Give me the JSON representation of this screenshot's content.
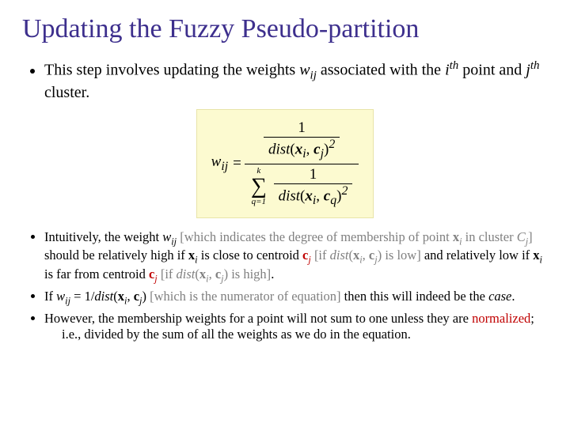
{
  "title": "Updating the Fuzzy Pseudo-partition",
  "bullets": {
    "b1": {
      "t1": "This step involves updating the weights ",
      "w": "w",
      "ij": "ij",
      "t2": " associated with the ",
      "i": "i",
      "th1": "th",
      "t3": " point and ",
      "j": "j",
      "th2": "th",
      "t4": " cluster."
    },
    "b2": {
      "t1": "Intuitively, the weight ",
      "w": "w",
      "ij": "ij",
      "gray1a": " [which indicates the degree of membership of point ",
      "xi_b": "x",
      "xi_s": "i",
      "gray1b": " in cluster ",
      "Cj_b": "C",
      "Cj_s": "j",
      "gray1c": "]",
      "t2": " should be relatively high if ",
      "xib": "x",
      "xis": "i",
      "t3": " is close to centroid ",
      "cjb": "c",
      "cjs": "j",
      "gray2a": " [if ",
      "dist1": "dist",
      "d1p": "(",
      "d1x": "x",
      "d1xi": "i",
      "d1comma": ", ",
      "d1c": "c",
      "d1cj": "j",
      "d1close": ")",
      "gray2b": " is low]",
      "t4": " and relatively low if ",
      "xib2": "x",
      "xis2": "i",
      "t5": " is far from centroid ",
      "cjb2": "c",
      "cjs2": "j",
      "gray3a": " [if ",
      "dist2": "dist",
      "d2p": "(",
      "d2x": "x",
      "d2xi": "i",
      "d2comma": ", ",
      "d2c": "c",
      "d2cj": "j",
      "d2close": ")",
      "gray3b": " is high]",
      "period": "."
    },
    "b3": {
      "t1": "If ",
      "w": "w",
      "ij": "ij",
      "eq": " = 1/",
      "dist": "dist",
      "p": "(",
      "x": "x",
      "xi": "i",
      "comma": ", ",
      "c": "c",
      "cj": "j",
      "close": ")",
      "gray": " [which is the numerator of equation]",
      "t2": " then this will indeed be the ",
      "case": "case",
      "t3": "."
    },
    "b4": {
      "t1": "However, the membership weights for a point will not sum to one unless they are ",
      "norm": "normalized",
      "t2": ";",
      "t3": "i.e., divided by the sum of all the weights as we do in the equation."
    }
  },
  "formula": {
    "lhs_w": "w",
    "lhs_ij": "ij",
    "eq": " = ",
    "num_top": "1",
    "num_dist": "dist",
    "num_args_x": "x",
    "num_args_xi": "i",
    "num_args_c": "c",
    "num_args_cj": "j",
    "num_exp": "2",
    "den_k": "k",
    "den_q1": "q=1",
    "den_dist": "dist",
    "den_args_x": "x",
    "den_args_xi": "i",
    "den_args_c": "c",
    "den_args_cq": "q",
    "den_exp": "2"
  }
}
